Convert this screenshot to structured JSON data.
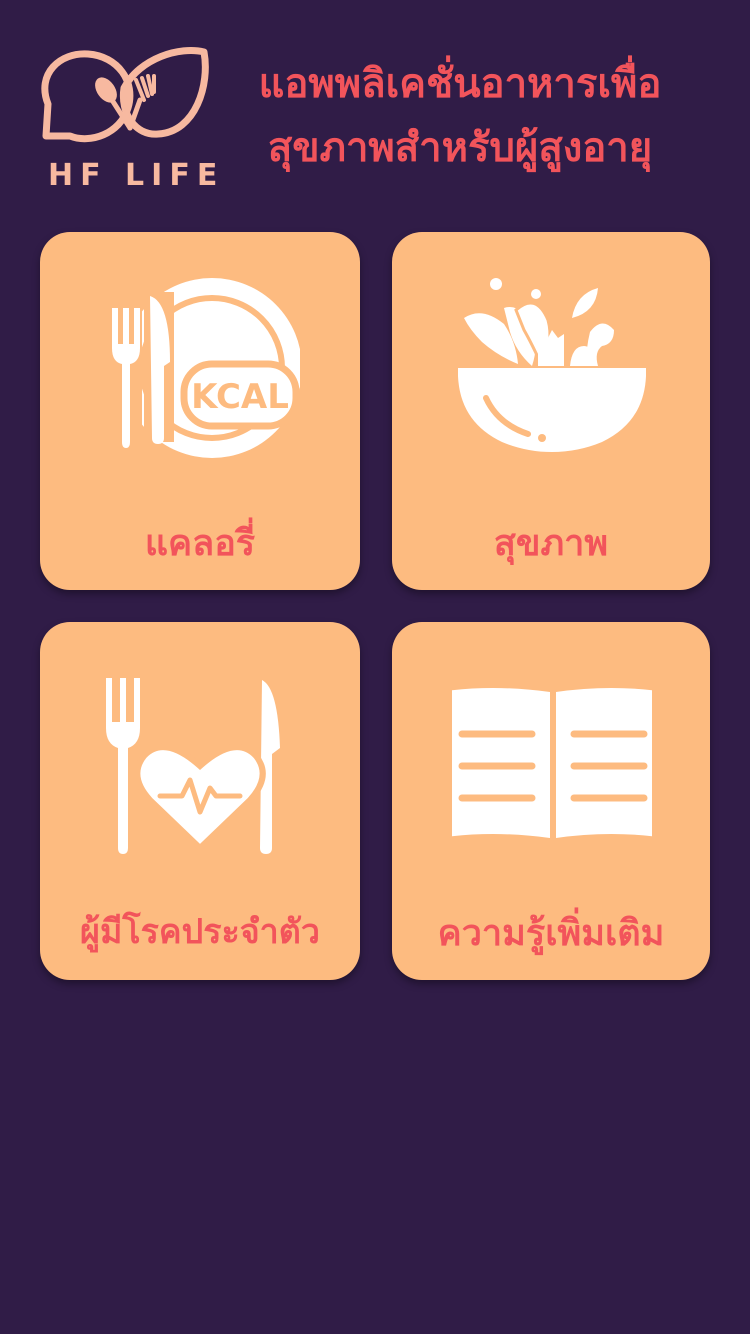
{
  "header": {
    "logo_text": "HF LIFE",
    "title_line1": "แอพพลิเคชั่นอาหารเพื่อ",
    "title_line2": "สุขภาพสำหรับผู้สูงอายุ"
  },
  "menu": [
    {
      "label": "แคลอรี่",
      "icon": "kcal-plate-icon",
      "icon_text": "KCAL"
    },
    {
      "label": "สุขภาพ",
      "icon": "salad-bowl-icon"
    },
    {
      "label": "ผู้มีโรคประจำตัว",
      "icon": "heart-cutlery-icon"
    },
    {
      "label": "ความรู้เพิ่มเติม",
      "icon": "open-book-icon"
    }
  ],
  "colors": {
    "background": "#301c47",
    "card": "#fdbb80",
    "accent": "#f2545b",
    "logo": "#f7b9a0",
    "icon": "#ffffff"
  }
}
